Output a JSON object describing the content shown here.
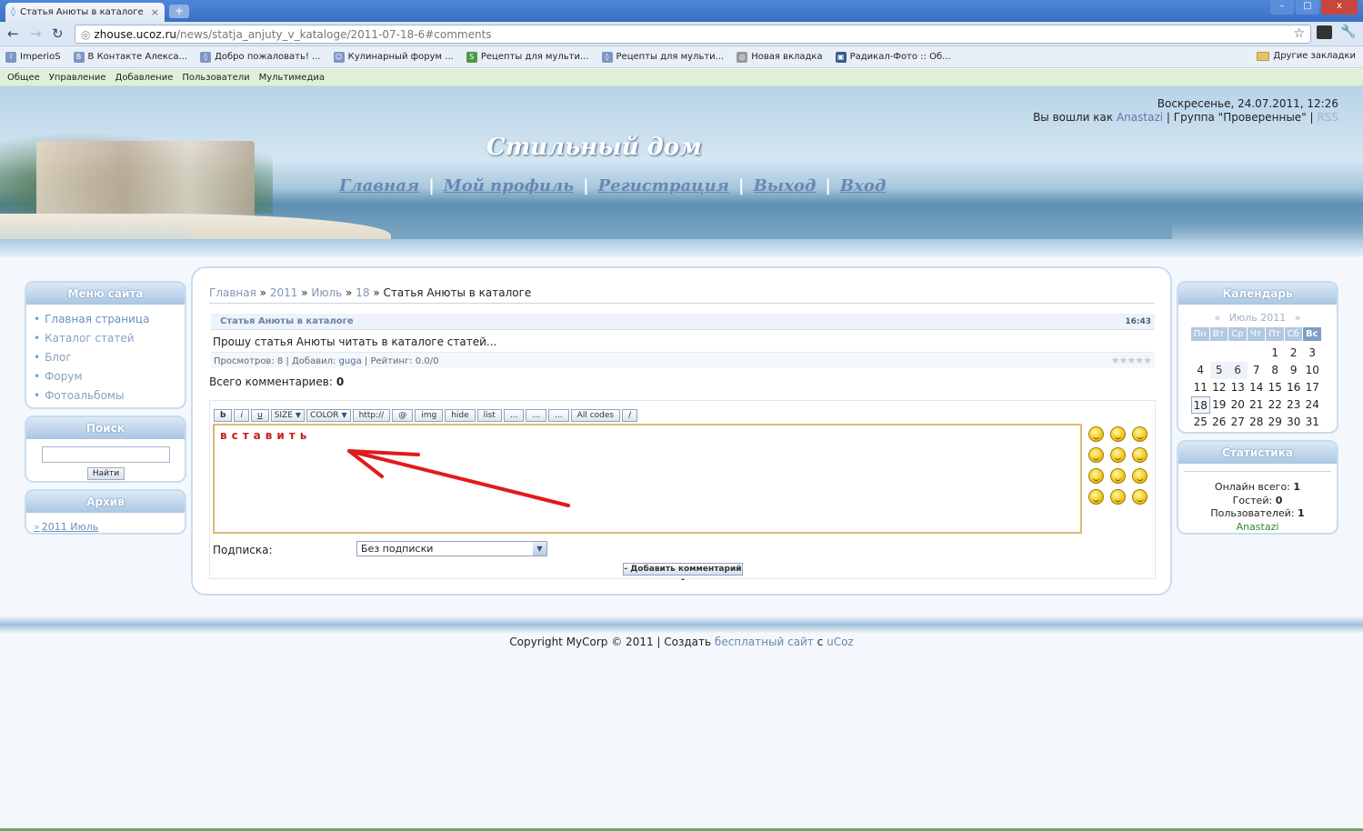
{
  "browser": {
    "tab_title": "Статья Анюты в каталоге -",
    "new_tab": "+",
    "window_buttons": [
      "–",
      "□",
      "x"
    ],
    "url_host": "zhouse.ucoz.ru",
    "url_path": "/news/statja_anjuty_v_kataloge/2011-07-18-6#comments",
    "bookmarks": [
      "ImperioS",
      "В Контакте  Алекса...",
      "Добро пожаловать! ...",
      "Кулинарный форум ...",
      "Рецепты для мульти...",
      "Рецепты для мульти...",
      "Новая вкладка",
      "Радикал-Фото :: Об..."
    ],
    "bookmark_icons": [
      "I",
      "В",
      "◊",
      "☺",
      "S",
      "◊",
      "◎",
      "▣"
    ],
    "other_bookmarks": "Другие закладки"
  },
  "adminbar": [
    "Общее",
    "Управление",
    "Добавление",
    "Пользователи",
    "Мультимедиа"
  ],
  "header": {
    "site_title": "Стильный дом",
    "nav": [
      "Главная",
      "Мой профиль",
      "Регистрация",
      "Выход",
      "Вход"
    ],
    "date": "Воскресенье, 24.07.2011, 12:26",
    "login_prefix": "Вы вошли как",
    "user": "Anastazi",
    "group_prefix": "| Группа \"",
    "group": "Проверенные",
    "group_suffix": "\" |",
    "rss": "RSS"
  },
  "left": {
    "menu_title": "Меню сайта",
    "menu_items": [
      "Главная страница",
      "Каталог статей",
      "Блог",
      "Форум",
      "Фотоальбомы"
    ],
    "search_title": "Поиск",
    "search_button": "Найти",
    "archive_title": "Архив",
    "archive_link": "2011 Июль"
  },
  "main": {
    "breadcrumb": [
      "Главная",
      "2011",
      "Июль",
      "18"
    ],
    "breadcrumb_sep": "»",
    "breadcrumb_current": "Статья Анюты в каталоге",
    "entry_title": "Статья Анюты в каталоге",
    "entry_time": "16:43",
    "entry_text": "Прошу статья Анюты читать в каталоге статей...",
    "meta_views": "Просмотров: 8 | Добавил:",
    "meta_author": "guga",
    "meta_rating": "| Рейтинг: 0.0/0",
    "stars": "★★★★★",
    "comments_label": "Всего комментариев:",
    "comments_count": "0",
    "bbcodes": [
      "b",
      "i",
      "u",
      "SIZE",
      "COLOR",
      "http://",
      "@",
      "img",
      "hide",
      "list",
      "...",
      "...",
      "...",
      "All codes",
      "/"
    ],
    "textarea_value": "вставить",
    "subscribe_label": "Подписка:",
    "subscribe_value": "Без подписки",
    "add_button": "- Добавить комментарий -"
  },
  "right": {
    "calendar_title": "Календарь",
    "calendar_prev": "«",
    "calendar_month": "Июль 2011",
    "calendar_next": "»",
    "weekdays": [
      "Пн",
      "Вт",
      "Ср",
      "Чт",
      "Пт",
      "Сб",
      "Вс"
    ],
    "days": [
      "",
      "",
      "",
      "",
      "1",
      "2",
      "3",
      "4",
      "5",
      "6",
      "7",
      "8",
      "9",
      "10",
      "11",
      "12",
      "13",
      "14",
      "15",
      "16",
      "17",
      "18",
      "19",
      "20",
      "21",
      "22",
      "23",
      "24",
      "25",
      "26",
      "27",
      "28",
      "29",
      "30",
      "31"
    ],
    "stats_title": "Статистика",
    "online_total": "Онлайн всего:",
    "online_total_value": "1",
    "guests": "Гостей:",
    "guests_value": "0",
    "users": "Пользователей:",
    "users_value": "1",
    "user": "Anastazi"
  },
  "footer": {
    "text": "Copyright MyCorp © 2011 | Создать",
    "link1": "бесплатный сайт",
    "mid": "с",
    "link2": "uCoz"
  },
  "colors": {
    "accent": "#6b86b4",
    "annotation_arrow": "#e01b1b"
  }
}
